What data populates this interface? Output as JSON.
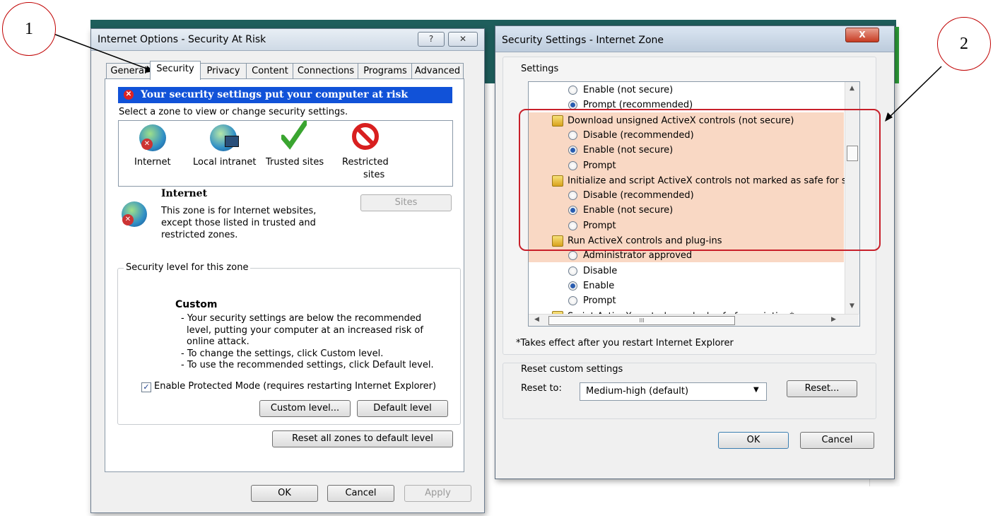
{
  "callouts": {
    "one": "1",
    "two": "2"
  },
  "internet_options": {
    "title": "Internet Options - Security At Risk",
    "help_btn": "?",
    "close_btn": "✕",
    "tabs": [
      "General",
      "Security",
      "Privacy",
      "Content",
      "Connections",
      "Programs",
      "Advanced"
    ],
    "banner": "Your security settings put your computer at risk",
    "zone_prompt": "Select a zone to view or change security settings.",
    "zones": [
      "Internet",
      "Local intranet",
      "Trusted sites",
      "Restricted"
    ],
    "zone_restricted_line2": "sites",
    "sites_btn": "Sites",
    "zone_title": "Internet",
    "zone_desc_1": "This zone is for Internet websites,",
    "zone_desc_2": "except those listed in trusted and",
    "zone_desc_3": "restricted zones.",
    "level_group": "Security level for this zone",
    "level_name": "Custom",
    "level_lines": [
      "- Your security settings are below the recommended",
      "level, putting your computer at an increased risk of",
      "online attack.",
      "- To change the settings, click Custom level.",
      "- To use the recommended settings, click Default level."
    ],
    "protected_mode": "Enable Protected Mode (requires restarting Internet Explorer)",
    "custom_level_btn": "Custom level...",
    "default_level_btn": "Default level",
    "reset_all_btn": "Reset all zones to default level",
    "ok": "OK",
    "cancel": "Cancel",
    "apply": "Apply"
  },
  "security_settings": {
    "title": "Security Settings - Internet Zone",
    "close_btn": "X",
    "settings_label": "Settings",
    "list": [
      {
        "type": "radio",
        "label": "Enable (not secure)",
        "on": false
      },
      {
        "type": "radio",
        "label": "Prompt (recommended)",
        "on": true
      },
      {
        "type": "header",
        "label": "Download unsigned ActiveX controls (not secure)"
      },
      {
        "type": "radio",
        "label": "Disable (recommended)",
        "on": false
      },
      {
        "type": "radio",
        "label": "Enable (not secure)",
        "on": true
      },
      {
        "type": "radio",
        "label": "Prompt",
        "on": false
      },
      {
        "type": "header",
        "label": "Initialize and script ActiveX controls not marked as safe for s"
      },
      {
        "type": "radio",
        "label": "Disable (recommended)",
        "on": false
      },
      {
        "type": "radio",
        "label": "Enable (not secure)",
        "on": true
      },
      {
        "type": "radio",
        "label": "Prompt",
        "on": false
      },
      {
        "type": "header",
        "label": "Run ActiveX controls and plug-ins"
      },
      {
        "type": "radio",
        "label": "Administrator approved",
        "on": false
      },
      {
        "type": "radio",
        "label": "Disable",
        "on": false
      },
      {
        "type": "radio",
        "label": "Enable",
        "on": true
      },
      {
        "type": "radio",
        "label": "Prompt",
        "on": false
      },
      {
        "type": "header",
        "label": "Script ActiveX controls marked safe for scripting*"
      }
    ],
    "note": "*Takes effect after you restart Internet Explorer",
    "reset_group": "Reset custom settings",
    "reset_to": "Reset to:",
    "reset_value": "Medium-high (default)",
    "reset_btn": "Reset...",
    "ok": "OK",
    "cancel": "Cancel"
  },
  "colors": {
    "highlight": "#f9d8c4",
    "callout_border": "#c00000",
    "banner": "#1152d8"
  }
}
